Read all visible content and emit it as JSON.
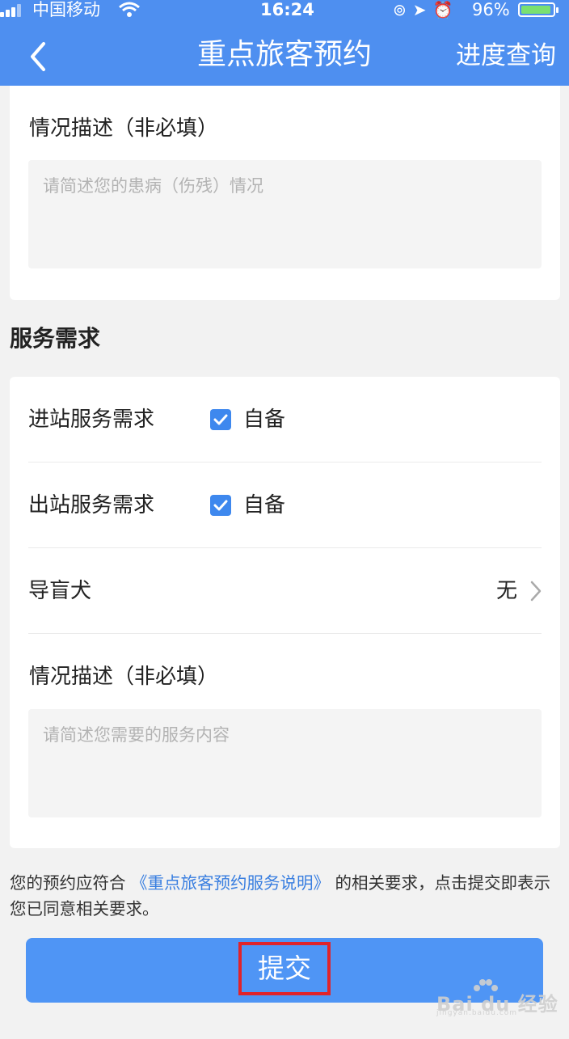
{
  "status_bar": {
    "carrier": "中国移动",
    "time": "16:24",
    "battery_percent_text": "96%",
    "battery_level": 0.96,
    "icons": [
      "signal-icon",
      "wifi-icon",
      "rotation-lock-icon",
      "location-icon",
      "alarm-icon",
      "battery-icon"
    ]
  },
  "nav": {
    "title": "重点旅客预约",
    "right_action": "进度查询",
    "back_icon": "chevron-left-icon"
  },
  "condition_section": {
    "label": "情况描述（非必填）",
    "placeholder": "请简述您的患病（伤残）情况"
  },
  "service_section": {
    "title": "服务需求",
    "rows": [
      {
        "label": "进站服务需求",
        "checkbox_text": "自备",
        "checked": true
      },
      {
        "label": "出站服务需求",
        "checkbox_text": "自备",
        "checked": true
      },
      {
        "label": "导盲犬",
        "value": "无"
      }
    ],
    "description_label": "情况描述（非必填）",
    "description_placeholder": "请简述您需要的服务内容"
  },
  "notice": {
    "prefix": "您的预约应符合 ",
    "link": "《重点旅客预约服务说明》",
    "suffix": " 的相关要求，点击提交即表示您已同意相关要求。"
  },
  "submit_label": "提交",
  "watermark": {
    "text": "Bai du 经验",
    "sub": "jingyan.baidu.com"
  },
  "colors": {
    "primary": "#4e8ff0",
    "link": "#3a7fe0",
    "checkbox": "#3e88ee",
    "highlight_box": "#e0232a"
  }
}
